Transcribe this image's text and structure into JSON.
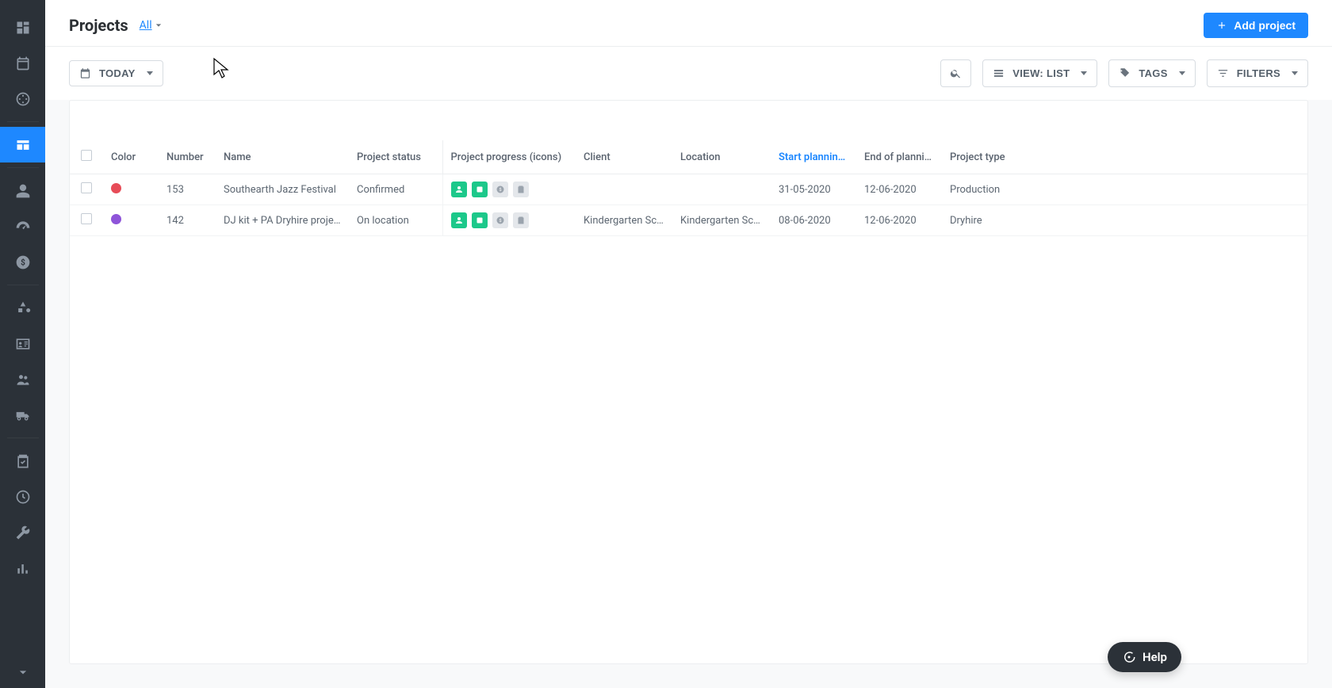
{
  "page": {
    "title": "Projects",
    "filter_link": "All"
  },
  "buttons": {
    "add_project": "Add project",
    "today": "TODAY",
    "view": "VIEW: LIST",
    "tags": "TAGS",
    "filters": "FILTERS",
    "help": "Help"
  },
  "columns": {
    "color": "Color",
    "number": "Number",
    "name": "Name",
    "status": "Project status",
    "progress": "Project progress (icons)",
    "client": "Client",
    "location": "Location",
    "start": "Start planning p…",
    "end": "End of planning …",
    "type": "Project type"
  },
  "rows": [
    {
      "color": "#e74c58",
      "number": "153",
      "name": "Southearth Jazz Festival",
      "status": "Confirmed",
      "client": "",
      "location": "",
      "start": "31-05-2020",
      "end": "12-06-2020",
      "type": "Production"
    },
    {
      "color": "#8e54d9",
      "number": "142",
      "name": "DJ kit + PA Dryhire project",
      "status": "On location",
      "client": "Kindergarten Sc…",
      "location": "Kindergarten Sc…",
      "start": "08-06-2020",
      "end": "12-06-2020",
      "type": "Dryhire"
    }
  ]
}
